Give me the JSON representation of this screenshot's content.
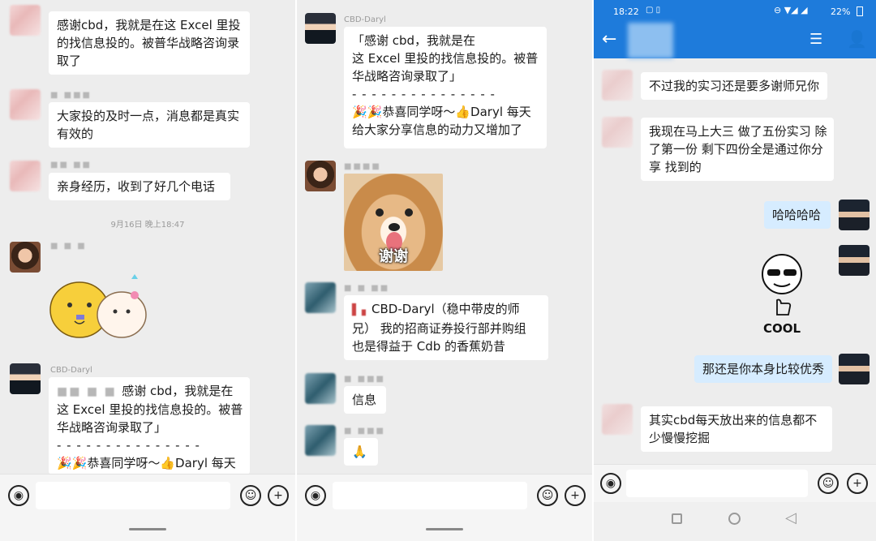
{
  "panel1": {
    "messages": [
      {
        "lines": [
          "感谢cbd，我就是在这 Excel 里投",
          "的找信息投的。被普华战略咨询录",
          "取了"
        ]
      },
      {
        "lines": [
          "大家投的及时一点，消息都是真实",
          "有效的"
        ]
      },
      {
        "lines": [
          "亲身经历，收到了好几个电话"
        ]
      }
    ],
    "time": "9月16日 晚上18:47",
    "cbd_name": "CBD-Daryl",
    "quote": {
      "head": "感谢 cbd，我就是在",
      "l2": "这 Excel 里投的找信息投的。被普",
      "l3": "华战略咨询录取了」",
      "dash": "- - - - - - - - - - - - - - -",
      "l5": "🎉🎉恭喜同学呀～👍Daryl 每天"
    }
  },
  "panel2": {
    "cbd_name": "CBD-Daryl",
    "quote": {
      "l1": "「感谢 cbd，我就是在",
      "l2": "这 Excel 里投的找信息投的。被普",
      "l3": "华战略咨询录取了」",
      "dash": "- - - - - - - - - - - - - - -",
      "l5": "🎉🎉恭喜同学呀～👍Daryl 每天",
      "l6": "给大家分享信息的动力又增加了"
    },
    "sticker_text": "谢谢",
    "msg2": {
      "l1": "CBD-Daryl（稳中带皮的师",
      "l2": "兄） 我的招商证券投行部并购组",
      "l3": "也是得益于 Cdb 的香蕉奶昔"
    },
    "msg3": "信息",
    "msg4": "🙏"
  },
  "panel3": {
    "status": {
      "time": "18:22",
      "battery": "22%"
    },
    "messages": [
      {
        "lines": [
          "不过我的实习还是要多谢师兄你"
        ]
      },
      {
        "lines": [
          "我现在马上大三 做了五份实习 除",
          "了第一份  剩下四份全是通过你分",
          "享          找到的"
        ]
      }
    ],
    "reply1": "哈哈哈哈",
    "sticker_text": "COOL",
    "reply2": "那还是你本身比较优秀",
    "msg_last": {
      "lines": [
        "其实cbd每天放出来的信息都不",
        "少慢慢挖掘"
      ]
    }
  },
  "colors": {
    "bubble": "#ffffff",
    "own_bubble": "#d6ecff",
    "title_bar": "#1e7bdb",
    "background": "#ededed"
  }
}
